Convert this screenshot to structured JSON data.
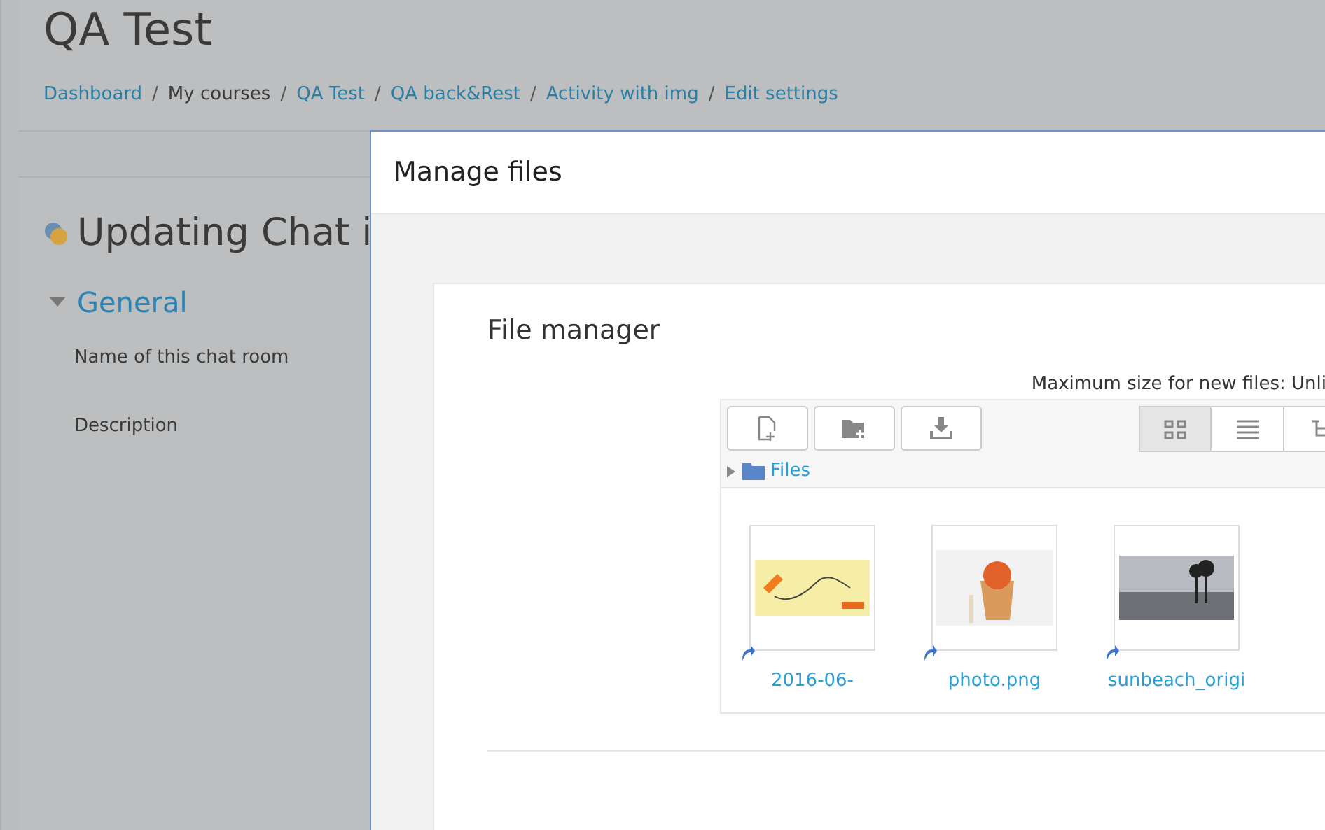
{
  "page": {
    "title": "QA Test",
    "breadcrumbs": [
      {
        "label": "Dashboard",
        "link": true
      },
      {
        "label": "My courses",
        "link": false
      },
      {
        "label": "QA Test",
        "link": true
      },
      {
        "label": "QA back&Rest",
        "link": true
      },
      {
        "label": "Activity with img",
        "link": true
      },
      {
        "label": "Edit settings",
        "link": true
      }
    ],
    "separator": "/",
    "heading": "Updating Chat i",
    "section": {
      "title": "General",
      "expanded": true
    },
    "fields": [
      "Name of this chat room",
      "Description"
    ]
  },
  "dialog": {
    "title": "Manage files",
    "form_label": "File manager",
    "max_size": "Maximum size for new files: Unli",
    "toolbar": [
      {
        "kind": "add-file"
      },
      {
        "kind": "add-folder"
      },
      {
        "kind": "download"
      }
    ],
    "views": [
      {
        "kind": "grid",
        "selected": true
      },
      {
        "kind": "list",
        "selected": false
      },
      {
        "kind": "tree",
        "selected": false
      }
    ],
    "path": {
      "label": "Files",
      "expanded": false
    },
    "files": [
      {
        "name": "2016-06-",
        "kind": "drawing"
      },
      {
        "name": "photo.png",
        "kind": "food"
      },
      {
        "name": "sunbeach_origi",
        "kind": "beach"
      }
    ]
  }
}
